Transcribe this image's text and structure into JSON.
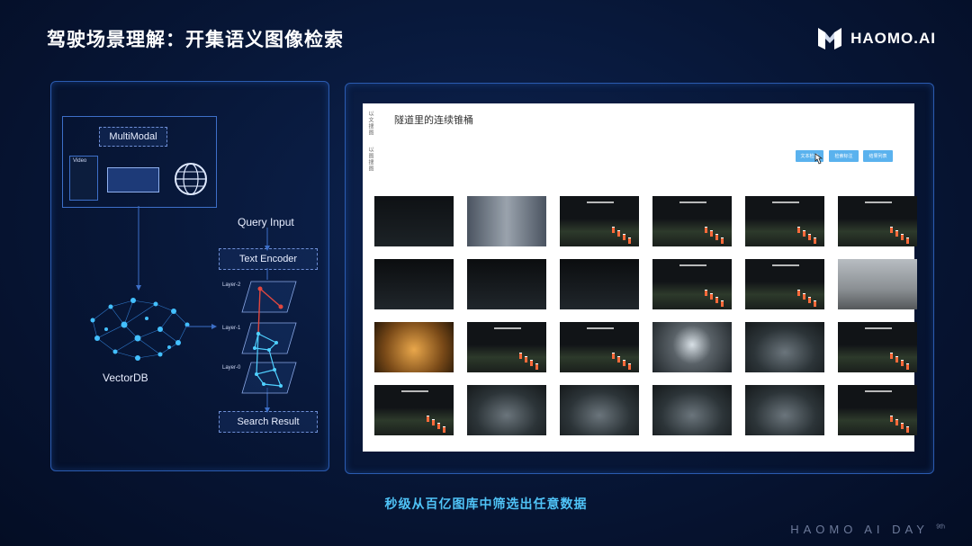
{
  "slide": {
    "title": "驾驶场景理解：开集语义图像检索",
    "caption": "秒级从百亿图库中筛选出任意数据",
    "footer": "HAOMO AI DAY",
    "footer_edition": "9th"
  },
  "logo": {
    "text": "HAOMO.AI",
    "icon": "haomo-logo-icon"
  },
  "diagram": {
    "multimodal": "MultiModal",
    "video": "Video",
    "query_input": "Query Input",
    "text_encoder": "Text Encoder",
    "layers": [
      "Layer-2",
      "Layer-1",
      "Layer-0"
    ],
    "vectordb": "VectorDB",
    "search_result": "Search Result"
  },
  "app": {
    "query": "隧道里的连续锥桶",
    "side_tabs": [
      "以文搜图",
      "以图搜图"
    ],
    "buttons": [
      "文本检索",
      "检索标注",
      "结果列表"
    ],
    "result_count": 24
  },
  "colors": {
    "accent": "#4fc3f7",
    "panel_border": "#2b5bb0",
    "button": "#5ab2ee"
  }
}
